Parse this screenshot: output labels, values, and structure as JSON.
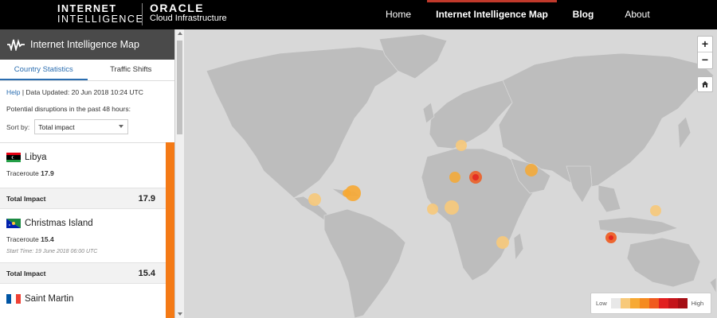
{
  "brand": {
    "line1": "INTERNET",
    "line2": "INTELLIGENCE",
    "oracle": "ORACLE",
    "oracle_sub": "Cloud Infrastructure"
  },
  "nav": {
    "home": "Home",
    "map": "Internet Intelligence Map",
    "blog": "Blog",
    "about": "About"
  },
  "sidebar": {
    "title": "Internet Intelligence Map",
    "tabs": [
      "Country Statistics",
      "Traffic Shifts"
    ],
    "help": "Help",
    "updated": " | Data Updated: 20 Jun 2018 10:24 UTC",
    "disruptions": "Potential disruptions in the past 48 hours:",
    "sort_label": "Sort by:",
    "sort_value": "Total impact",
    "impact_label": "Total Impact",
    "countries": [
      {
        "name": "Libya",
        "metric": "Traceroute",
        "value": "17.9",
        "impact": "17.9",
        "start": ""
      },
      {
        "name": "Christmas Island",
        "metric": "Traceroute",
        "value": "15.4",
        "impact": "15.4",
        "start": "Start Time: 19 June 2018 06:00 UTC"
      },
      {
        "name": "Saint Martin"
      }
    ]
  },
  "map": {
    "zoom_in": "+",
    "zoom_out": "−",
    "legend_low": "Low",
    "legend_high": "High",
    "legend_colors": [
      "#e8e8e8",
      "#f7c97a",
      "#f7a933",
      "#f58a1f",
      "#f05a1e",
      "#e21f1f",
      "#c4141a",
      "#a50f15"
    ]
  },
  "colors": {
    "accent": "#2a6db0",
    "impact_bar": "#f47a16",
    "nav_bg": "#000000",
    "sidebar_header": "#4a4a4a"
  }
}
